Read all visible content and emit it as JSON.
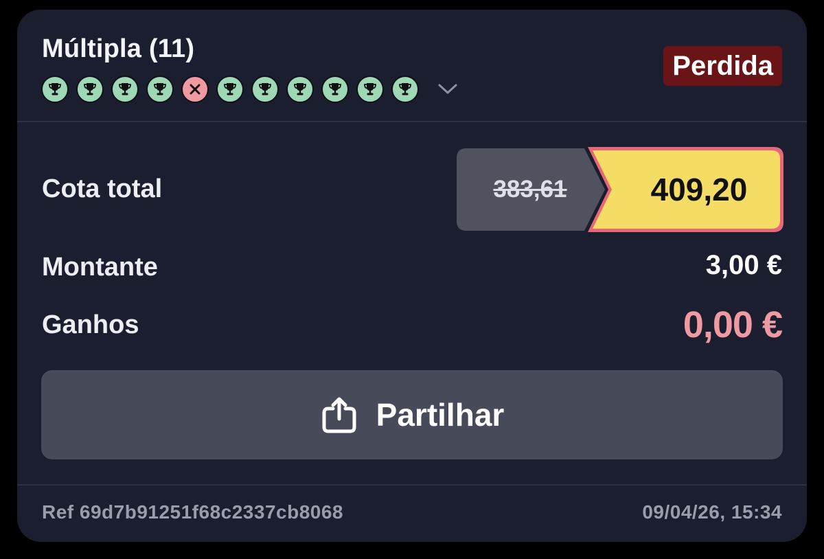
{
  "bet": {
    "title": "Múltipla (11)",
    "status": "Perdida",
    "legs": [
      {
        "result": "win",
        "icon": "trophy-icon"
      },
      {
        "result": "win",
        "icon": "trophy-icon"
      },
      {
        "result": "win",
        "icon": "trophy-icon"
      },
      {
        "result": "win",
        "icon": "trophy-icon"
      },
      {
        "result": "loss",
        "icon": "cross-icon"
      },
      {
        "result": "win",
        "icon": "trophy-icon"
      },
      {
        "result": "win",
        "icon": "trophy-icon"
      },
      {
        "result": "win",
        "icon": "trophy-icon"
      },
      {
        "result": "win",
        "icon": "trophy-icon"
      },
      {
        "result": "win",
        "icon": "trophy-icon"
      },
      {
        "result": "win",
        "icon": "trophy-icon"
      }
    ]
  },
  "odds": {
    "label": "Cota total",
    "old_value": "383,61",
    "new_value": "409,20"
  },
  "stake": {
    "label": "Montante",
    "value": "3,00 €"
  },
  "winnings": {
    "label": "Ganhos",
    "value": "0,00 €"
  },
  "share": {
    "label": "Partilhar",
    "icon": "share-icon"
  },
  "footer": {
    "ref": "Ref 69d7b91251f68c2337cb8068",
    "datetime": "09/04/26, 15:34"
  },
  "colors": {
    "card_background": "#1b1e2e",
    "win": "#9ed8b5",
    "loss": "#ef9aa2",
    "status_badge": "#6b1418",
    "boosted_odds": "#f5dc64",
    "boost_border": "#e8667a",
    "old_odds_background": "#50535f",
    "share_button": "#474a59"
  }
}
